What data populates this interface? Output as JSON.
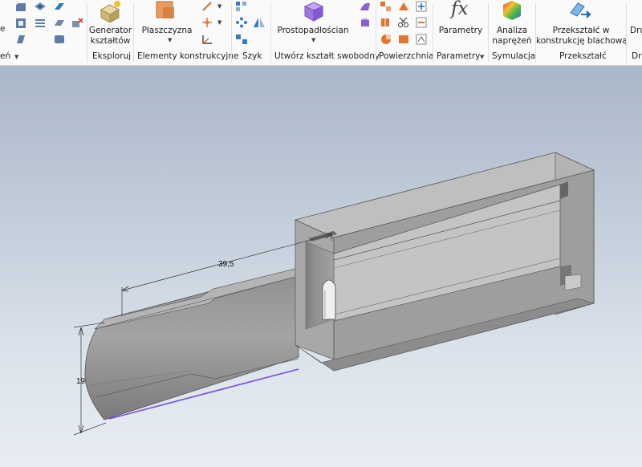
{
  "ribbon": {
    "groups": {
      "partial_left": "eń",
      "explore": "Eksploruj",
      "work_features": "Elementy konstrukcyjne",
      "pattern": "Szyk",
      "freeform": "Utwórz kształt swobodny",
      "surface": "Powierzchnia",
      "parameters": "Parametry",
      "simulation": "Symulacja",
      "convert": "Przekształć",
      "partial_right": "Dru"
    },
    "buttons": {
      "edge_char": "e",
      "shape_generator_l1": "Generator",
      "shape_generator_l2": "kształtów",
      "plane": "Płaszczyzna",
      "box": "Prostopadłościan",
      "parameters": "Parametry",
      "stress_l1": "Analiza",
      "stress_l2": "naprężeń",
      "convert_l1": "Przekształć w",
      "convert_l2": "konstrukcję blachową",
      "partial_dru": "Dru",
      "fx_symbol": "fx"
    }
  },
  "viewport": {
    "dimensions": {
      "length": "39,5",
      "height": "19"
    }
  }
}
